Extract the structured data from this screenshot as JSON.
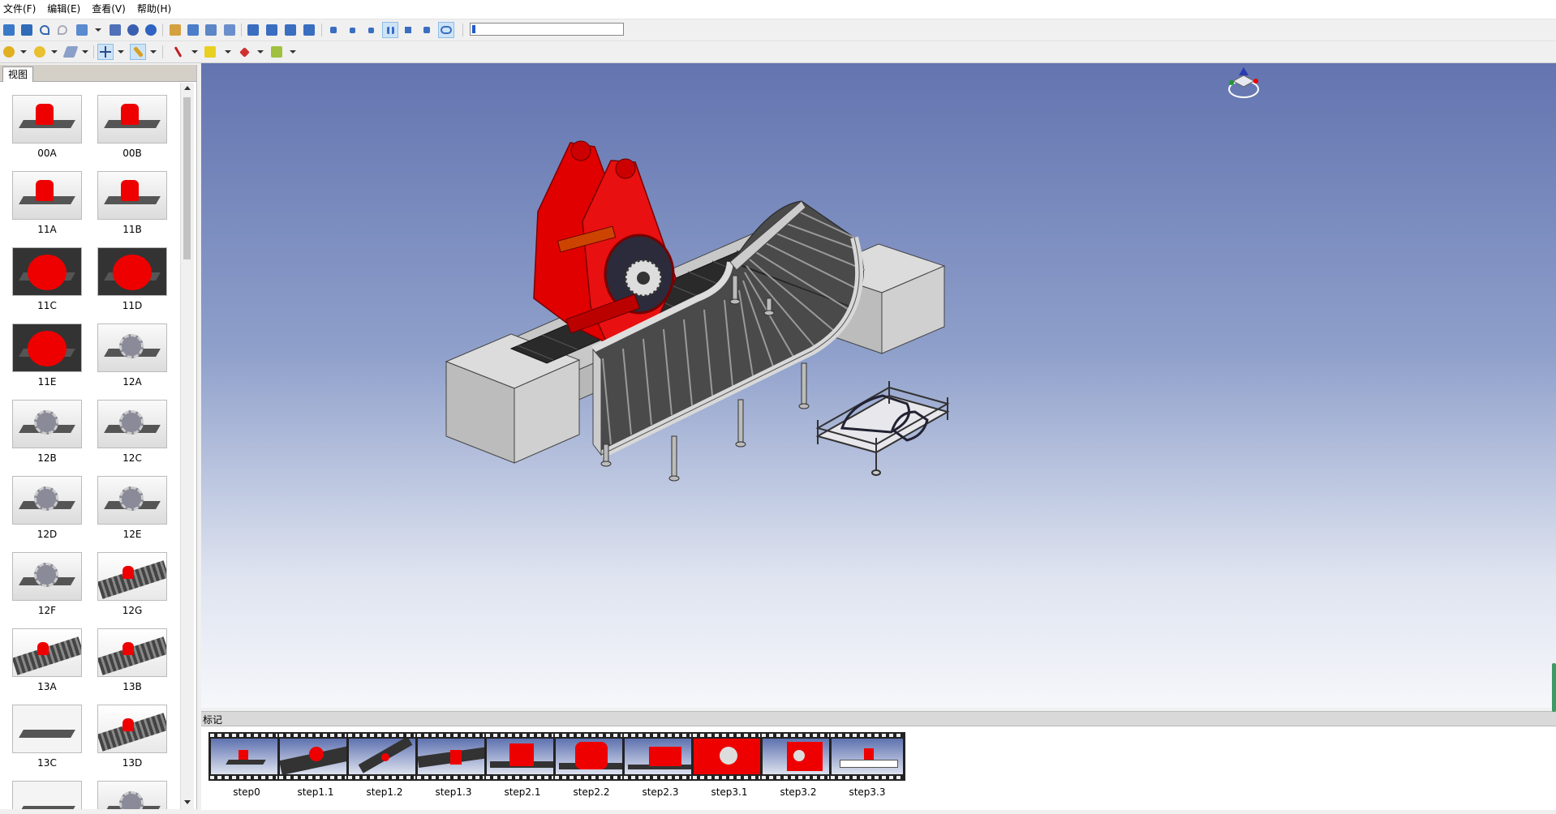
{
  "menu": [
    "文件(F)",
    "编辑(E)",
    "查看(V)",
    "帮助(H)"
  ],
  "toolbar1": {
    "icons": [
      "open-file-icon",
      "save-icon",
      "undo-icon",
      "redo-icon",
      "fit-view-icon",
      "view-menu-icon",
      "grid-icon",
      "settings-icon",
      "info-icon",
      "part-icon",
      "home-icon",
      "table-icon",
      "copy-view-icon",
      "pose1-icon",
      "pose2-icon",
      "pose3-icon",
      "pose4-icon",
      "skip-start-icon",
      "step-back-icon",
      "play-icon",
      "pause-icon",
      "stop-icon",
      "skip-end-icon",
      "loop-icon"
    ],
    "progress": 0.02
  },
  "toolbar2": {
    "icons": [
      "lamp-icon",
      "sun-icon",
      "plane-icon",
      "move-icon",
      "pen-icon",
      "measure-icon",
      "note-icon",
      "eraser-icon",
      "material-icon"
    ]
  },
  "left_panel": {
    "tab": "视图",
    "thumbnails": [
      {
        "label": "00A",
        "style": "belt"
      },
      {
        "label": "00B",
        "style": "belt"
      },
      {
        "label": "11A",
        "style": "belt"
      },
      {
        "label": "11B",
        "style": "belt"
      },
      {
        "label": "11C",
        "style": "red"
      },
      {
        "label": "11D",
        "style": "red"
      },
      {
        "label": "11E",
        "style": "red"
      },
      {
        "label": "12A",
        "style": "grey"
      },
      {
        "label": "12B",
        "style": "grey"
      },
      {
        "label": "12C",
        "style": "grey"
      },
      {
        "label": "12D",
        "style": "grey"
      },
      {
        "label": "12E",
        "style": "grey"
      },
      {
        "label": "12F",
        "style": "grey"
      },
      {
        "label": "12G",
        "style": "curve"
      },
      {
        "label": "13A",
        "style": "curve"
      },
      {
        "label": "13B",
        "style": "curve"
      },
      {
        "label": "13C",
        "style": "bolt"
      },
      {
        "label": "13D",
        "style": "curve"
      },
      {
        "label": "",
        "style": "bolt"
      },
      {
        "label": "",
        "style": "grey"
      }
    ]
  },
  "marker_panel": {
    "title": "标记",
    "steps": [
      "step0",
      "step1.1",
      "step1.2",
      "step1.3",
      "step2.1",
      "step2.2",
      "step2.3",
      "step3.1",
      "step3.2",
      "step3.3"
    ]
  },
  "colors": {
    "accent": "#1e5bd0",
    "model_red": "#e00000",
    "bg_top": "#6374b0",
    "bg_bottom": "#f6f7fb"
  }
}
